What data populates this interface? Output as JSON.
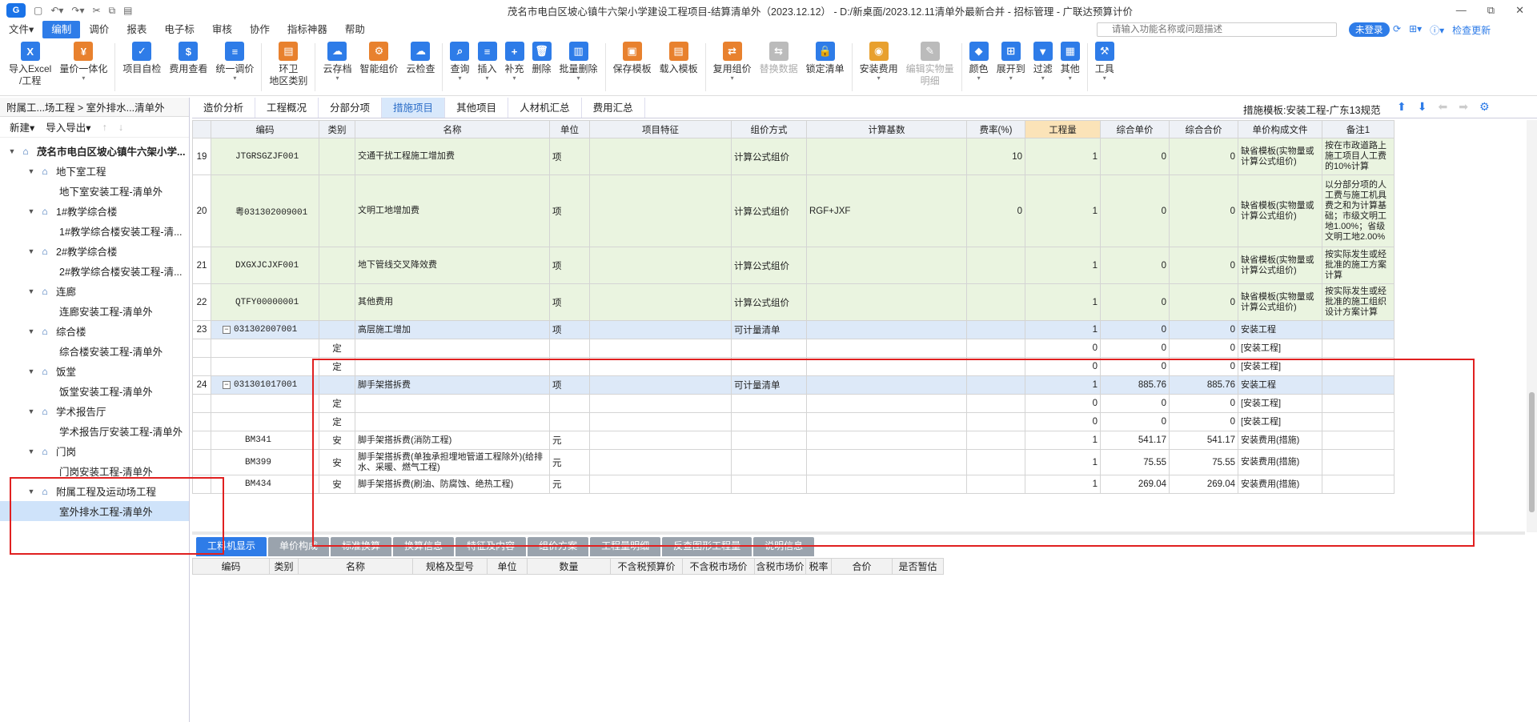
{
  "window": {
    "title": "茂名市电白区坡心镇牛六架小学建设工程项目-结算清单外（2023.12.12） - D:/新桌面/2023.12.11清单外最新合并 - 招标管理 - 广联达预算计价",
    "controls": [
      "—",
      "⧉",
      "✕"
    ]
  },
  "menu": [
    "文件▾",
    "编制",
    "调价",
    "报表",
    "电子标",
    "审核",
    "协作",
    "指标神器",
    "帮助"
  ],
  "search": {
    "placeholder": "请输入功能名称或问题描述"
  },
  "login": "未登录",
  "check_update": "检查更新",
  "ribbon": [
    {
      "label": "导入Excel\n/工程",
      "color": "#2e7ce8",
      "glyph": "X"
    },
    {
      "label": "量价一体化",
      "color": "#e8812e",
      "glyph": "¥",
      "arrow": true
    },
    {
      "label": "项目自检",
      "color": "#2e7ce8",
      "glyph": "✓"
    },
    {
      "label": "费用查看",
      "color": "#2e7ce8",
      "glyph": "$"
    },
    {
      "label": "统一调价",
      "color": "#2e7ce8",
      "glyph": "≡",
      "arrow": true
    },
    {
      "label": "环卫\n地区类别",
      "color": "#e8812e",
      "glyph": "▤"
    },
    {
      "label": "云存档",
      "color": "#2e7ce8",
      "glyph": "☁",
      "arrow": true
    },
    {
      "label": "智能组价",
      "color": "#e8812e",
      "glyph": "⚙"
    },
    {
      "label": "云检查",
      "color": "#2e7ce8",
      "glyph": "☁"
    },
    {
      "label": "查询",
      "color": "#2e7ce8",
      "glyph": "⌕",
      "arrow": true
    },
    {
      "label": "插入",
      "color": "#2e7ce8",
      "glyph": "≡",
      "arrow": true
    },
    {
      "label": "补充",
      "color": "#2e7ce8",
      "glyph": "+",
      "arrow": true
    },
    {
      "label": "删除",
      "color": "#2e7ce8",
      "glyph": "🗑"
    },
    {
      "label": "批量删除",
      "color": "#2e7ce8",
      "glyph": "▥",
      "arrow": true
    },
    {
      "label": "保存模板",
      "color": "#e8812e",
      "glyph": "▣"
    },
    {
      "label": "载入模板",
      "color": "#e8812e",
      "glyph": "▤"
    },
    {
      "label": "复用组价",
      "color": "#e8812e",
      "glyph": "⇄",
      "arrow": true
    },
    {
      "label": "替换数据",
      "color": "#bbbbbb",
      "glyph": "⇆",
      "disabled": true
    },
    {
      "label": "锁定清单",
      "color": "#2e7ce8",
      "glyph": "🔒"
    },
    {
      "label": "安装费用",
      "color": "#e8a02e",
      "glyph": "◉",
      "arrow": true
    },
    {
      "label": "编辑实物量\n明细",
      "color": "#bbbbbb",
      "glyph": "✎",
      "disabled": true
    },
    {
      "label": "颜色",
      "color": "#2e7ce8",
      "glyph": "◆",
      "arrow": true
    },
    {
      "label": "展开到",
      "color": "#2e7ce8",
      "glyph": "⊞",
      "arrow": true
    },
    {
      "label": "过滤",
      "color": "#2e7ce8",
      "glyph": "▼",
      "arrow": true
    },
    {
      "label": "其他",
      "color": "#2e7ce8",
      "glyph": "▦",
      "arrow": true
    },
    {
      "label": "工具",
      "color": "#2e7ce8",
      "glyph": "⚒",
      "arrow": true
    }
  ],
  "nav": {
    "header": "附属工...场工程 > 室外排水...清单外",
    "new_label": "新建▾",
    "import_label": "导入导出▾",
    "tree": [
      {
        "level": 0,
        "label": "茂名市电白区坡心镇牛六架小学...",
        "bold": true,
        "toggle": "▼"
      },
      {
        "level": 1,
        "label": "地下室工程",
        "toggle": "▼"
      },
      {
        "level": 2,
        "label": "地下室安装工程-清单外"
      },
      {
        "level": 1,
        "label": "1#教学综合楼",
        "toggle": "▼"
      },
      {
        "level": 2,
        "label": "1#教学综合楼安装工程-清..."
      },
      {
        "level": 1,
        "label": "2#教学综合楼",
        "toggle": "▼"
      },
      {
        "level": 2,
        "label": "2#教学综合楼安装工程-清..."
      },
      {
        "level": 1,
        "label": "连廊",
        "toggle": "▼"
      },
      {
        "level": 2,
        "label": "连廊安装工程-清单外"
      },
      {
        "level": 1,
        "label": "综合楼",
        "toggle": "▼"
      },
      {
        "level": 2,
        "label": "综合楼安装工程-清单外"
      },
      {
        "level": 1,
        "label": "饭堂",
        "toggle": "▼"
      },
      {
        "level": 2,
        "label": "饭堂安装工程-清单外"
      },
      {
        "level": 1,
        "label": "学术报告厅",
        "toggle": "▼"
      },
      {
        "level": 2,
        "label": "学术报告厅安装工程-清单外"
      },
      {
        "level": 1,
        "label": "门岗",
        "toggle": "▼"
      },
      {
        "level": 2,
        "label": "门岗安装工程-清单外"
      },
      {
        "level": 1,
        "label": "附属工程及运动场工程",
        "toggle": "▼"
      },
      {
        "level": 2,
        "label": "室外排水工程-清单外",
        "selected": true
      }
    ]
  },
  "tabs": [
    "造价分析",
    "工程概况",
    "分部分项",
    "措施项目",
    "其他项目",
    "人材机汇总",
    "费用汇总"
  ],
  "active_tab": "措施项目",
  "template_info": "措施模板:安装工程-广东13规范",
  "grid": {
    "headers": [
      "",
      "编码",
      "类别",
      "名称",
      "单位",
      "项目特征",
      "组价方式",
      "计算基数",
      "费率(%)",
      "工程量",
      "综合单价",
      "综合合价",
      "单价构成文件",
      "备注1"
    ],
    "rows": [
      {
        "no": "19",
        "code": "JTGRSGZJF001",
        "type": "",
        "name": "交通干扰工程施工增加费",
        "unit": "项",
        "feature": "",
        "method": "计算公式组价",
        "base": "",
        "rate": "10",
        "qty": "1",
        "price": "0",
        "total": "0",
        "file": "缺省模板(实物量或计算公式组价)",
        "note": "按在市政道路上施工项目人工费的10%计算",
        "style": "green",
        "h": 46
      },
      {
        "no": "20",
        "code": "粤031302009001",
        "type": "",
        "name": "文明工地增加费",
        "unit": "项",
        "feature": "",
        "method": "计算公式组价",
        "base": "RGF+JXF",
        "rate": "0",
        "qty": "1",
        "price": "0",
        "total": "0",
        "file": "缺省模板(实物量或计算公式组价)",
        "note": "以分部分项的人工费与施工机具费之和为计算基础；市级文明工地1.00%；省级文明工地2.00%",
        "style": "green",
        "h": 90
      },
      {
        "no": "21",
        "code": "DXGXJCJXF001",
        "type": "",
        "name": "地下管线交叉降效费",
        "unit": "项",
        "feature": "",
        "method": "计算公式组价",
        "base": "",
        "rate": "",
        "qty": "1",
        "price": "0",
        "total": "0",
        "file": "缺省模板(实物量或计算公式组价)",
        "note": "按实际发生或经批准的施工方案计算",
        "style": "green",
        "h": 46
      },
      {
        "no": "22",
        "code": "QTFY00000001",
        "type": "",
        "name": "其他费用",
        "unit": "项",
        "feature": "",
        "method": "计算公式组价",
        "base": "",
        "rate": "",
        "qty": "1",
        "price": "0",
        "total": "0",
        "file": "缺省模板(实物量或计算公式组价)",
        "note": "按实际发生或经批准的施工组织设计方案计算",
        "style": "green",
        "h": 46
      },
      {
        "no": "23",
        "code": "031302007001",
        "type": "",
        "name": "高层施工增加",
        "unit": "项",
        "feature": "",
        "method": "可计量清单",
        "base": "",
        "rate": "",
        "qty": "1",
        "price": "0",
        "total": "0",
        "file": "安装工程",
        "note": "",
        "style": "blue",
        "h": 23,
        "mark": "−"
      },
      {
        "no": "",
        "code": "",
        "type": "定",
        "name": "",
        "unit": "",
        "feature": "",
        "method": "",
        "base": "",
        "rate": "",
        "qty": "0",
        "price": "0",
        "total": "0",
        "file": "[安装工程]",
        "note": "",
        "style": "",
        "h": 23,
        "child": true
      },
      {
        "no": "",
        "code": "",
        "type": "定",
        "name": "",
        "unit": "",
        "feature": "",
        "method": "",
        "base": "",
        "rate": "",
        "qty": "0",
        "price": "0",
        "total": "0",
        "file": "[安装工程]",
        "note": "",
        "style": "",
        "h": 23,
        "child": true
      },
      {
        "no": "24",
        "code": "031301017001",
        "type": "",
        "name": "脚手架搭拆费",
        "unit": "项",
        "feature": "",
        "method": "可计量清单",
        "base": "",
        "rate": "",
        "qty": "1",
        "price": "885.76",
        "total": "885.76",
        "file": "安装工程",
        "note": "",
        "style": "blue",
        "h": 23,
        "mark": "−"
      },
      {
        "no": "",
        "code": "",
        "type": "定",
        "name": "",
        "unit": "",
        "feature": "",
        "method": "",
        "base": "",
        "rate": "",
        "qty": "0",
        "price": "0",
        "total": "0",
        "file": "[安装工程]",
        "note": "",
        "style": "",
        "h": 23,
        "child": true
      },
      {
        "no": "",
        "code": "",
        "type": "定",
        "name": "",
        "unit": "",
        "feature": "",
        "method": "",
        "base": "",
        "rate": "",
        "qty": "0",
        "price": "0",
        "total": "0",
        "file": "[安装工程]",
        "note": "",
        "style": "",
        "h": 23,
        "child": true
      },
      {
        "no": "",
        "code": "BM341",
        "type": "安",
        "name": "脚手架搭拆费(消防工程)",
        "unit": "元",
        "feature": "",
        "method": "",
        "base": "",
        "rate": "",
        "qty": "1",
        "price": "541.17",
        "total": "541.17",
        "file": "安装费用(措施)",
        "note": "",
        "style": "",
        "h": 23,
        "child": true
      },
      {
        "no": "",
        "code": "BM399",
        "type": "安",
        "name": "脚手架搭拆费(单独承担埋地管道工程除外)(给排水、采暖、燃气工程)",
        "unit": "元",
        "feature": "",
        "method": "",
        "base": "",
        "rate": "",
        "qty": "1",
        "price": "75.55",
        "total": "75.55",
        "file": "安装费用(措施)",
        "note": "",
        "style": "",
        "h": 32,
        "child": true
      },
      {
        "no": "",
        "code": "BM434",
        "type": "安",
        "name": "脚手架搭拆费(刷油、防腐蚀、绝热工程)",
        "unit": "元",
        "feature": "",
        "method": "",
        "base": "",
        "rate": "",
        "qty": "1",
        "price": "269.04",
        "total": "269.04",
        "file": "安装费用(措施)",
        "note": "",
        "style": "",
        "h": 23,
        "child": true
      }
    ]
  },
  "bottom_tabs": [
    "工料机显示",
    "单价构成",
    "标准换算",
    "换算信息",
    "特征及内容",
    "组价方案",
    "工程量明细",
    "反查图形工程量",
    "说明信息"
  ],
  "bottom_active": "工料机显示",
  "bottom_headers": [
    "编码",
    "类别",
    "名称",
    "规格及型号",
    "单位",
    "数量",
    "不含税预算价",
    "不含税市场价",
    "含税市场价",
    "税率",
    "合价",
    "是否暂估"
  ],
  "accent": "#2e7ce8",
  "annotation_color": "#e02020"
}
